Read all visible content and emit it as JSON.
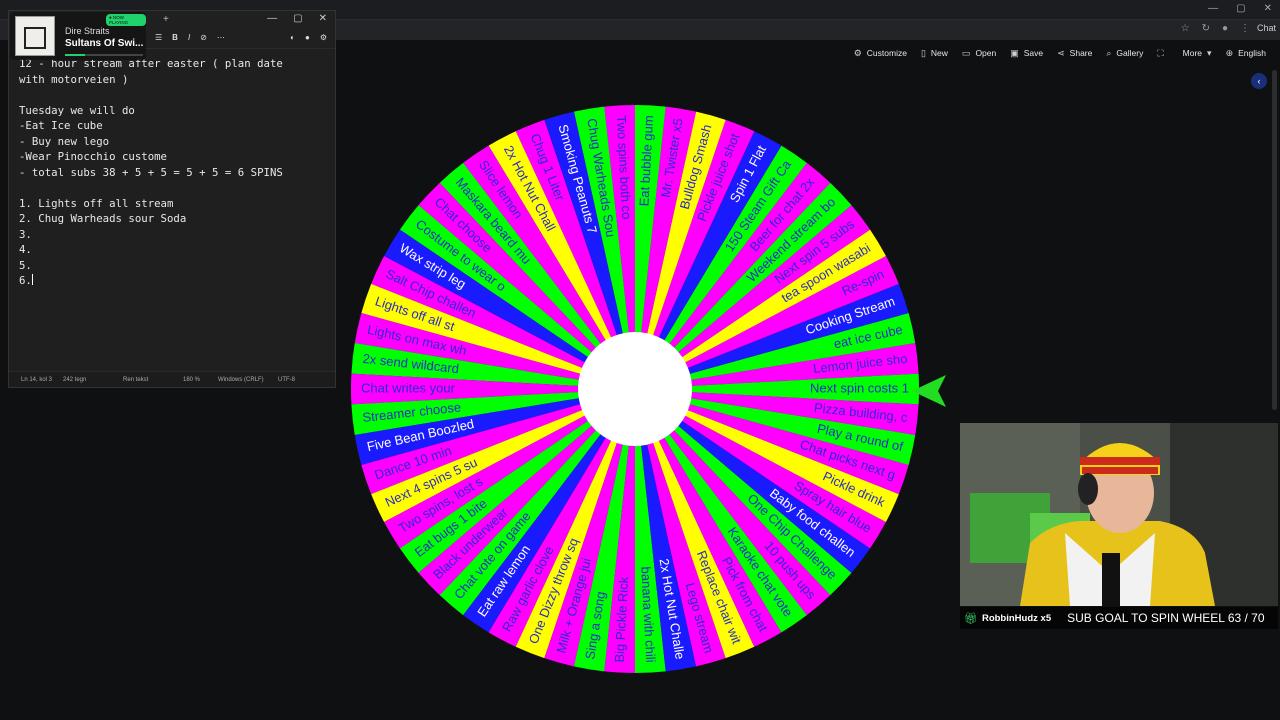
{
  "browser": {
    "chat_label": "Chat"
  },
  "toolbar": {
    "items": [
      {
        "icon": "gear-icon",
        "glyph": "⚙",
        "label": "Customize"
      },
      {
        "icon": "file-icon",
        "glyph": "▯",
        "label": "New"
      },
      {
        "icon": "folder-icon",
        "glyph": "▭",
        "label": "Open"
      },
      {
        "icon": "save-icon",
        "glyph": "▣",
        "label": "Save"
      },
      {
        "icon": "share-icon",
        "glyph": "⋖",
        "label": "Share"
      },
      {
        "icon": "search-icon",
        "glyph": "⌕",
        "label": "Gallery"
      },
      {
        "icon": "fullscreen-icon",
        "glyph": "⛶",
        "label": ""
      },
      {
        "icon": "chevron-down-icon",
        "glyph": "▾",
        "label": "More"
      },
      {
        "icon": "globe-icon",
        "glyph": "⊕",
        "label": "English"
      }
    ]
  },
  "notepad": {
    "lines": [
      "12 - hour stream after easter ( plan date",
      "with motorveien )",
      "",
      "Tuesday we will do",
      "-Eat Ice cube",
      "- Buy new lego",
      "-Wear Pinocchio custome",
      "- total subs 38 + 5 + 5 = 5 + 5 = 6 SPINS",
      "",
      "1. Lights off all stream",
      "2. Chug Warheads sour Soda",
      "3.",
      "4.",
      "5.",
      "6."
    ],
    "status": {
      "position": "Ln 14, kol 3",
      "chars": "242 tegn",
      "format": "Ren tekst",
      "zoom": "180 %",
      "line_endings": "Windows (CRLF)",
      "encoding": "UTF-8"
    }
  },
  "now_playing": {
    "badge": "● NOW PLAYING",
    "artist": "Dire Straits",
    "song": "Sultans Of Swi...",
    "progress": 0.25
  },
  "wheel": {
    "colors": [
      "#ff00ff",
      "#00ff00",
      "#1a1aff",
      "#ff00ff",
      "#ffff00",
      "#ff00ff",
      "#00ff00"
    ],
    "segments": [
      "Lemon juice sho",
      "eat ice cube",
      "Cooking Stream",
      "Re-spin",
      "tea spoon wasabi",
      "Next spin 5 subs",
      "Weekend stream bo",
      "Beer for chat 2x",
      "150 Steam Gift Ca",
      "Spin 1 Flat",
      "Pickle juice shot",
      "Bulldog Smash",
      "Mr. Twister x5",
      "Eat bubble gum",
      "Two spins both co",
      "Chug Warheads Sou",
      "Smoking Peanuts 7",
      "Chug 1 Liter",
      "2x Hot Nut Chall",
      "Slice lemon",
      "Maskara beard mu",
      "Chat choose",
      "Costume to wear o",
      "Wax strip leg",
      "Salt Chip challen",
      "Lights off all st",
      "Lights on max wh",
      "2x send wildcard",
      "Chat writes your",
      "Streamer choose",
      "Five Bean Boozled",
      "Dance 10 min",
      "Next 4 spins 5 su",
      "Two spins, lost s",
      "Eat bugs 1 bite",
      "Black underwear",
      "Chat vote on game",
      "Eat raw lemon",
      "Raw garlic clove",
      "One Dizzy throw sq",
      "Milk + Orange jui",
      "Sing a song",
      "Big Pickle Rick",
      "banana with chili",
      "2x Hot Nut Challe",
      "Lego stream",
      "Replace chair wit",
      "Pick from chat",
      "Karaoke chat vote",
      "10 push ups",
      "One Chip Challenge",
      "Baby food challen",
      "Spray hair blue",
      "Pickle drink",
      "Chat picks next g",
      "Play a round of",
      "Pizza building, c",
      "Next spin costs 1"
    ],
    "pointer_color": "#22dd22",
    "hub_color": "#ffffff"
  },
  "webcam": {
    "gift_icon": "gift-icon",
    "username": "RobbinHudz x5",
    "goal_text": "SUB GOAL TO SPIN WHEEL 63 / 70",
    "sub_count": 63,
    "sub_goal": 70
  }
}
